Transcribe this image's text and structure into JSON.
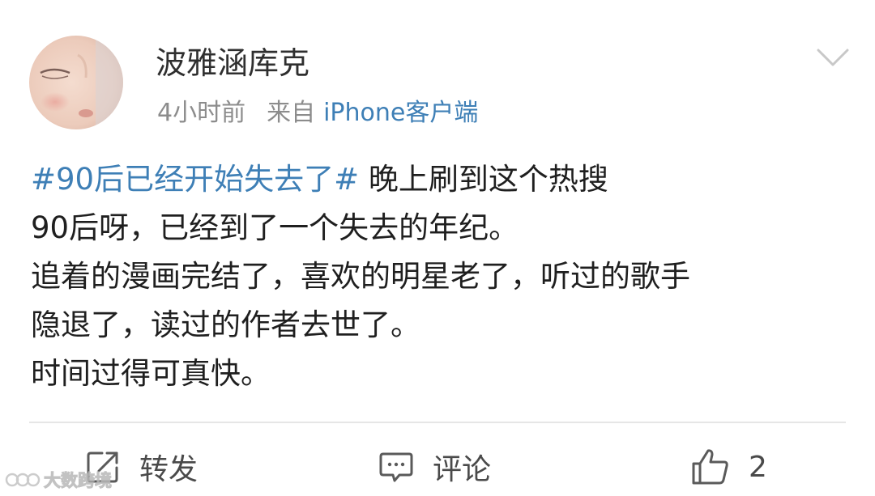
{
  "post": {
    "author": {
      "name": "波雅涵库克"
    },
    "meta": {
      "time": "4小时前",
      "from_label": "来自",
      "client": "iPhone客户端"
    },
    "content": {
      "hashtag": "#90后已经开始失去了#",
      "line1_rest": " 晚上刷到这个热搜",
      "line2": "90后呀，已经到了一个失去的年纪。",
      "line3": "追着的漫画完结了，喜欢的明星老了，听过的歌手",
      "line4": "隐退了，读过的作者去世了。",
      "line5": "时间过得可真快。"
    },
    "actions": {
      "repost_label": "转发",
      "comment_label": "评论",
      "like_count": "2"
    }
  },
  "watermark": {
    "text": "大数跨境"
  },
  "colors": {
    "link_blue": "#3e7fb6",
    "text_dark": "#1f1f1f",
    "text_gray": "#8c8c8c",
    "icon_gray": "#5a5a5a",
    "divider": "#e6e6e6"
  },
  "icons": {
    "chevron": "chevron-down-icon",
    "repost": "repost-icon",
    "comment": "comment-icon",
    "like": "thumbs-up-icon"
  }
}
